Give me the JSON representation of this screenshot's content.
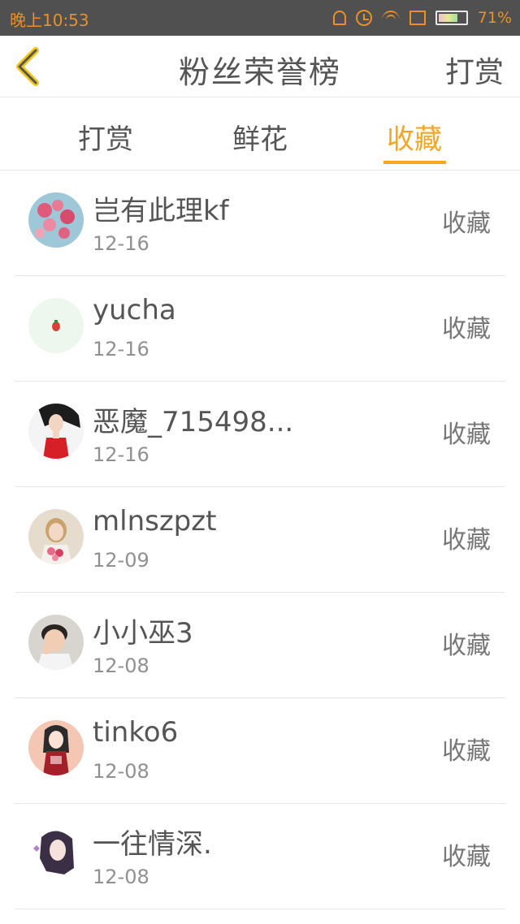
{
  "status_bar": {
    "time": "晚上10:53",
    "battery": "71%",
    "battery_level": 0.71,
    "icons": [
      "bell-icon",
      "alarm-clock-icon",
      "wifi-icon",
      "no-sim-icon",
      "battery-icon"
    ]
  },
  "header": {
    "back_icon": "chevron-left-icon",
    "title": "粉丝荣誉榜",
    "action": "打赏"
  },
  "tabs": [
    {
      "label": "打赏",
      "active": false
    },
    {
      "label": "鲜花",
      "active": false
    },
    {
      "label": "收藏",
      "active": true
    }
  ],
  "list": [
    {
      "name": "岂有此理kf",
      "date": "12-16",
      "action": "收藏"
    },
    {
      "name": "yucha",
      "date": "12-16",
      "action": "收藏"
    },
    {
      "name": "恶魔_715498...",
      "date": "12-16",
      "action": "收藏"
    },
    {
      "name": "mlnszpzt",
      "date": "12-09",
      "action": "收藏"
    },
    {
      "name": "小小巫3",
      "date": "12-08",
      "action": "收藏"
    },
    {
      "name": "tinko6",
      "date": "12-08",
      "action": "收藏"
    },
    {
      "name": "一往情深.",
      "date": "12-08",
      "action": "收藏"
    }
  ],
  "colors": {
    "accent": "#f5a623",
    "status_bar_bg": "#505050",
    "text_primary": "#555555",
    "text_secondary": "#909090",
    "divider": "#e6e6e6"
  }
}
